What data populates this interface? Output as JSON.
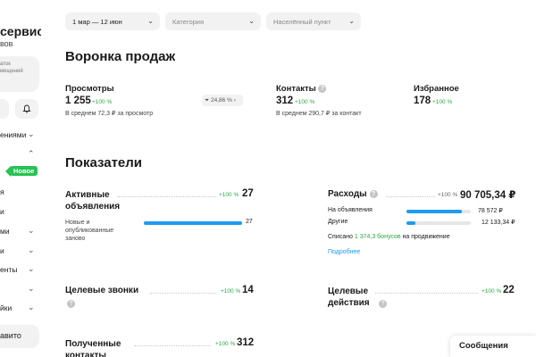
{
  "sidebar": {
    "title": "сервис",
    "subtitle": "вов",
    "card_line1": "аток",
    "card_line2": "мещений",
    "nav": [
      {
        "label": "ениями",
        "chevron": "⌄"
      },
      {
        "label": "",
        "chevron": "⌃"
      },
      {
        "label": "я",
        "chevron": ""
      },
      {
        "label": "и",
        "chevron": ""
      },
      {
        "label": "ми",
        "chevron": "⌄"
      },
      {
        "label": "и",
        "chevron": "⌄"
      },
      {
        "label": "енты",
        "chevron": "⌄"
      },
      {
        "label": "",
        "chevron": "⌄"
      },
      {
        "label": "йки",
        "chevron": "⌄"
      }
    ],
    "badge": "Новое",
    "bottom_button": "авито"
  },
  "filters": {
    "period": "1 мар — 12 июн",
    "category": "Категория",
    "location": "Населённый пункт"
  },
  "funnel": {
    "title": "Воронка продаж",
    "views": {
      "label": "Просмотры",
      "value": "1 255",
      "change": "+100 %",
      "note": "В среднем 72,3 ₽ за просмотр"
    },
    "conversion": "24,86 %",
    "contacts": {
      "label": "Контакты",
      "value": "312",
      "change": "+100 %",
      "note": "В среднем 290,7 ₽ за контакт"
    },
    "favorites": {
      "label": "Избранное",
      "value": "178",
      "change": "+100 %"
    }
  },
  "metrics": {
    "title": "Показатели",
    "active": {
      "label": "Активные объявления",
      "change": "+100 %",
      "value": "27",
      "sub_label": "Новые и опубликованные заново",
      "sub_value": "27"
    },
    "expenses": {
      "label": "Расходы",
      "change": "+100 %",
      "value": "90 705,34 ₽",
      "rows": [
        {
          "label": "На объявления",
          "value": "78 572 ₽",
          "share": 0.866
        },
        {
          "label": "Другие",
          "value": "12 133,34 ₽",
          "share": 0.134
        }
      ],
      "bonus_prefix": "Списано",
      "bonus_link": "1 374,3 бонусов",
      "bonus_suffix": "на продвижение",
      "more": "Подробнее"
    },
    "calls": {
      "label": "Целевые звонки",
      "change": "+100 %",
      "value": "14"
    },
    "actions": {
      "label": "Целевые действия",
      "change": "+100 %",
      "value": "22"
    },
    "received": {
      "label": "Полученные контакты",
      "change": "+100 %",
      "value": "312"
    }
  },
  "messages": "Сообщения",
  "colors": {
    "accent": "#1e9af0",
    "positive": "#28a745",
    "badge": "#28c254"
  }
}
